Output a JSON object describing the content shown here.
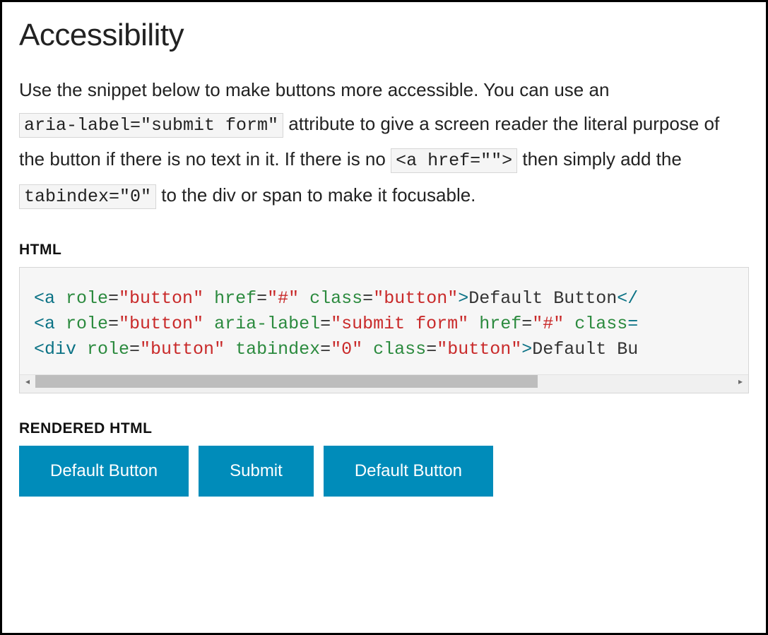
{
  "heading": "Accessibility",
  "description": {
    "t1": "Use the snippet below to make buttons more accessible. You can use an ",
    "c1": "aria-label=\"submit form\"",
    "t2": " attribute to give a screen reader the literal purpose of the button if there is no text in it. If there is no ",
    "c2": "<a href=\"\">",
    "t3": " then simply add the ",
    "c3": "tabindex=\"0\"",
    "t4": " to the div or span to make it focusable."
  },
  "html_label": "HTML",
  "rendered_label": "RENDERED HTML",
  "code": {
    "lines": [
      {
        "start": "<a ",
        "attrs": [
          {
            "n": "role",
            "v": "\"button\""
          },
          {
            "n": "href",
            "v": "\"#\""
          },
          {
            "n": "class",
            "v": "\"button\""
          }
        ],
        "close": ">",
        "text": "Default Button",
        "end": "</",
        "cutoff": true
      },
      {
        "start": "<a ",
        "attrs": [
          {
            "n": "role",
            "v": "\"button\""
          },
          {
            "n": "aria-label",
            "v": "\"submit form\""
          },
          {
            "n": "href",
            "v": "\"#\""
          },
          {
            "n": "class",
            "v": "",
            "noval": true
          }
        ],
        "close": "=",
        "text": "",
        "end": "",
        "cutoff": true
      },
      {
        "start": "<div ",
        "attrs": [
          {
            "n": "role",
            "v": "\"button\""
          },
          {
            "n": "tabindex",
            "v": "\"0\""
          },
          {
            "n": "class",
            "v": "\"button\""
          }
        ],
        "close": ">",
        "text": "Default Bu",
        "end": "",
        "cutoff": true
      }
    ]
  },
  "buttons": {
    "b1": "Default Button",
    "b2": "Submit",
    "b3": "Default Button"
  }
}
